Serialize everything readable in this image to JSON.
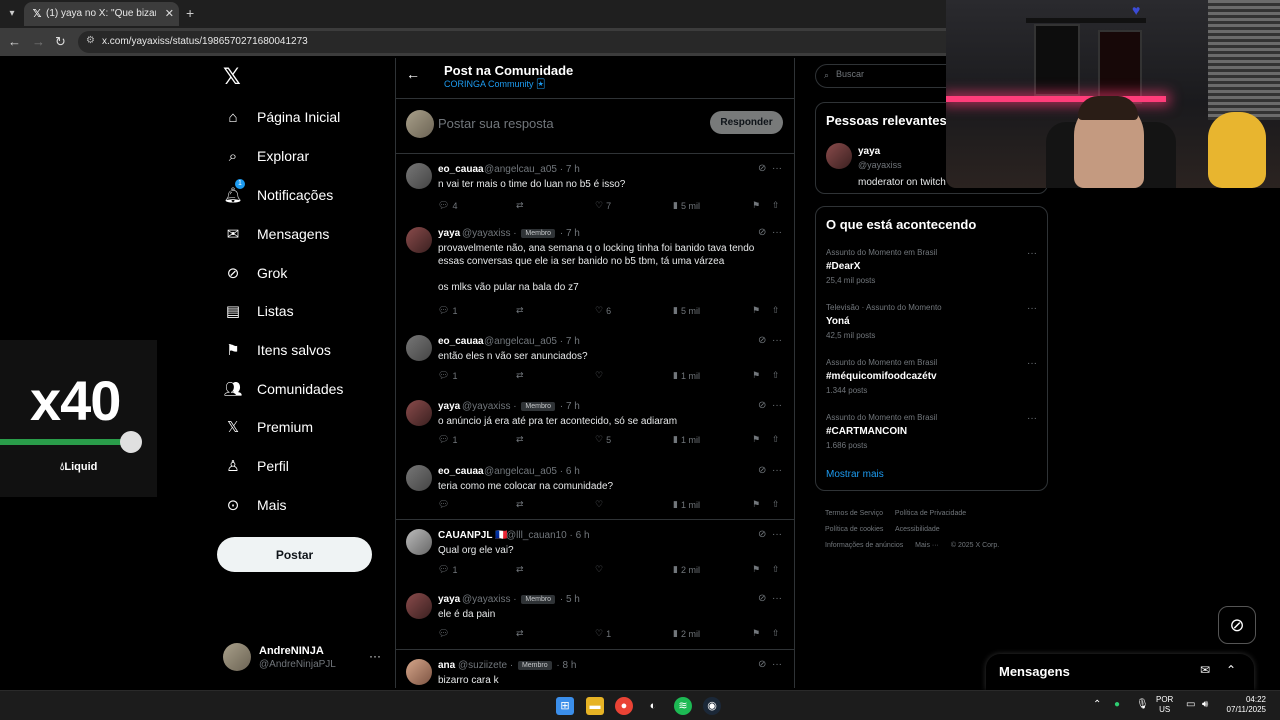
{
  "browser": {
    "tab_title": "(1) yaya no X: \"Que bizarro isso",
    "url": "x.com/yayaxiss/status/1986570271680041273"
  },
  "nav": {
    "items": [
      {
        "label": "Página Inicial",
        "icon": "home-icon"
      },
      {
        "label": "Explorar",
        "icon": "search-icon"
      },
      {
        "label": "Notificações",
        "icon": "bell-icon",
        "badge": "1"
      },
      {
        "label": "Mensagens",
        "icon": "mail-icon"
      },
      {
        "label": "Grok",
        "icon": "grok-icon"
      },
      {
        "label": "Listas",
        "icon": "list-icon"
      },
      {
        "label": "Itens salvos",
        "icon": "bookmark-icon"
      },
      {
        "label": "Comunidades",
        "icon": "people-icon"
      },
      {
        "label": "Premium",
        "icon": "x-icon"
      },
      {
        "label": "Perfil",
        "icon": "person-icon"
      },
      {
        "label": "Mais",
        "icon": "more-icon"
      }
    ],
    "post_button": "Postar",
    "account": {
      "name": "AndreNINJA",
      "handle": "@AndreNinjaPJL"
    }
  },
  "main": {
    "title": "Post na Comunidade",
    "subtitle": "CORINGA Community 🃏",
    "reply_placeholder": "Postar sua resposta",
    "reply_button": "Responder",
    "tweets": [
      {
        "name": "eo_cauaa",
        "handle": "@angelcau_a05",
        "time": "· 7 h",
        "badge": "",
        "text": "n vai ter mais o time do luan no b5 é isso?",
        "replies": "4",
        "likes": "7",
        "views": "5 mil"
      },
      {
        "name": "yaya",
        "handle": "@yayaxiss",
        "time": "· 7 h",
        "badge": "Membro",
        "text": "provavelmente não, ana semana q o locking tinha foi banido tava tendo essas conversas que ele ia ser banido no b5 tbm, tá uma várzea",
        "text2": "os mlks vão pular na bala do z7",
        "replies": "1",
        "likes": "6",
        "views": "5 mil"
      },
      {
        "name": "eo_cauaa",
        "handle": "@angelcau_a05",
        "time": "· 7 h",
        "badge": "",
        "text": "então eles n vão ser anunciados?",
        "replies": "1",
        "likes": "",
        "views": "1 mil"
      },
      {
        "name": "yaya",
        "handle": "@yayaxiss",
        "time": "· 7 h",
        "badge": "Membro",
        "text": "o anúncio já era até pra ter acontecido, só se adiaram",
        "replies": "1",
        "likes": "5",
        "views": "1 mil"
      },
      {
        "name": "eo_cauaa",
        "handle": "@angelcau_a05",
        "time": "· 6 h",
        "badge": "",
        "text": "teria como me colocar na comunidade?",
        "replies": "",
        "likes": "",
        "views": "1 mil"
      },
      {
        "name": "CAUANPJL 🇫🇷",
        "handle": "@lll_cauan10",
        "time": "· 6 h",
        "badge": "",
        "text": "Qual org ele vai?",
        "replies": "1",
        "likes": "",
        "views": "2 mil"
      },
      {
        "name": "yaya",
        "handle": "@yayaxiss",
        "time": "· 5 h",
        "badge": "Membro",
        "text": "ele é da pain",
        "replies": "",
        "likes": "1",
        "views": "2 mil"
      },
      {
        "name": "ana",
        "handle": "@suziizete",
        "time": "· 8 h",
        "badge": "Membro",
        "text": "bizarro cara k",
        "replies": "",
        "likes": "",
        "views": ""
      }
    ]
  },
  "right": {
    "search_placeholder": "Buscar",
    "relevant_title": "Pessoas relevantes",
    "person": {
      "name": "yaya",
      "handle": "@yayaxiss",
      "bio": "moderator on twitch"
    },
    "trends_title": "O que está acontecendo",
    "trends": [
      {
        "category": "Assunto do Momento em Brasil",
        "name": "#DearX",
        "count": "25,4 mil posts"
      },
      {
        "category": "Televisão · Assunto do Momento",
        "name": "Yoná",
        "count": "42,5 mil posts"
      },
      {
        "category": "Assunto do Momento em Brasil",
        "name": "#méquicomifoodcazétv",
        "count": "1.344 posts"
      },
      {
        "category": "Assunto do Momento em Brasil",
        "name": "#CARTMANCOIN",
        "count": "1.686 posts"
      }
    ],
    "show_more": "Mostrar mais",
    "footer": [
      "Termos de Serviço",
      "Política de Privacidade",
      "Política de cookies",
      "Acessibilidade",
      "Informações de anúncios",
      "Mais ···",
      "© 2025 X Corp."
    ]
  },
  "messages": {
    "title": "Mensagens"
  },
  "widget": {
    "value": "x40",
    "brand": "Liquid"
  },
  "taskbar": {
    "lang1": "POR",
    "lang2": "US",
    "time": "04:22",
    "date": "07/11/2025"
  }
}
